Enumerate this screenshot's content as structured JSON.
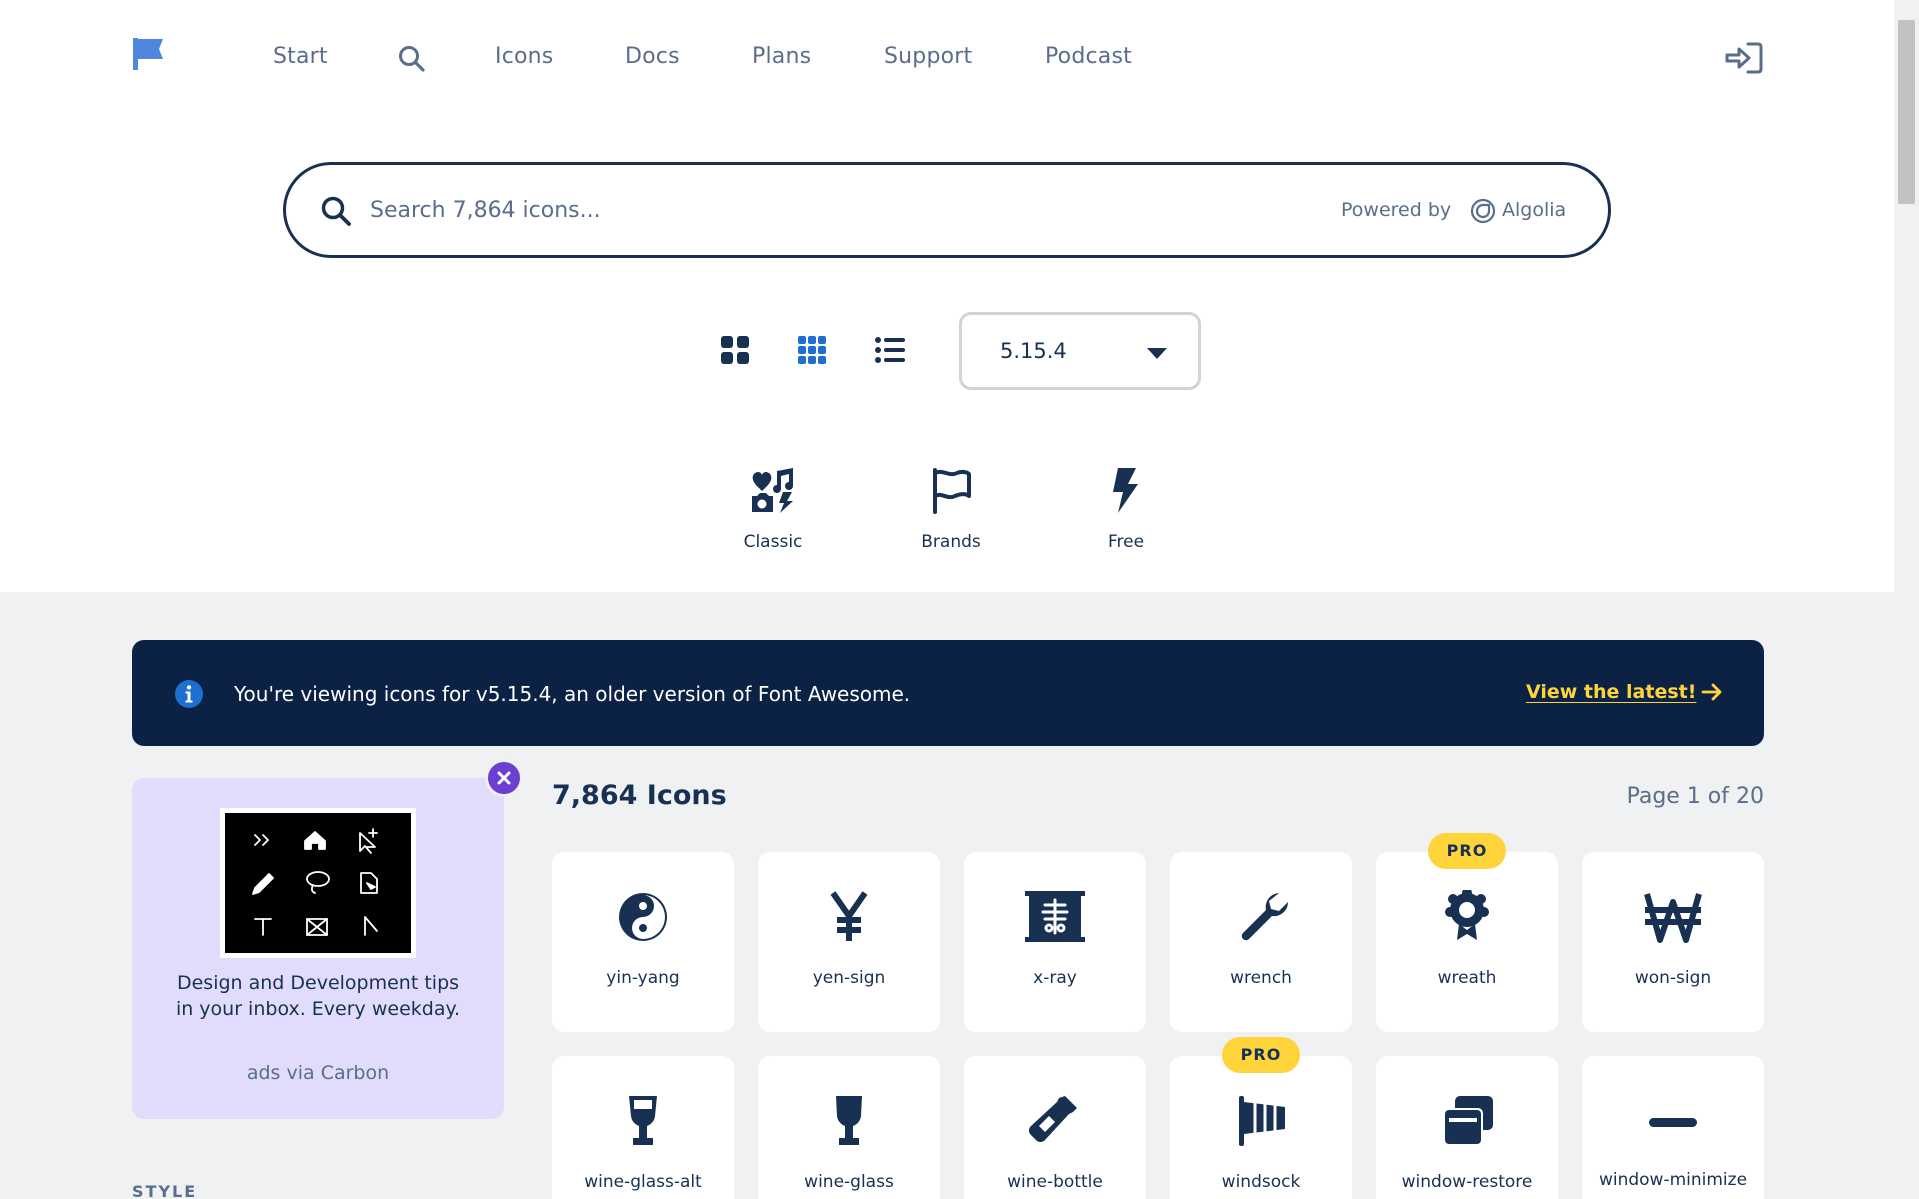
{
  "nav": {
    "links": [
      "Start",
      "Icons",
      "Docs",
      "Plans",
      "Support",
      "Podcast"
    ]
  },
  "search": {
    "placeholder": "Search 7,864 icons...",
    "powered_by": "Powered by",
    "provider": "Algolia"
  },
  "view": {
    "version": "5.15.4",
    "families": [
      "Classic",
      "Brands",
      "Free"
    ]
  },
  "banner": {
    "text": "You're viewing icons for v5.15.4, an older version of Font Awesome.",
    "link": "View the latest!"
  },
  "ad": {
    "text": "Design and Development tips in your inbox. Every weekday.",
    "via": "ads via Carbon"
  },
  "sidebar": {
    "style_label": "STYLE"
  },
  "results": {
    "count": "7,864 Icons",
    "page": "Page 1 of 20",
    "icons": [
      {
        "name": "yin-yang",
        "pro": ""
      },
      {
        "name": "yen-sign",
        "pro": ""
      },
      {
        "name": "x-ray",
        "pro": ""
      },
      {
        "name": "wrench",
        "pro": ""
      },
      {
        "name": "wreath",
        "pro": "PRO"
      },
      {
        "name": "won-sign",
        "pro": ""
      },
      {
        "name": "wine-glass-alt",
        "pro": ""
      },
      {
        "name": "wine-glass",
        "pro": ""
      },
      {
        "name": "wine-bottle",
        "pro": ""
      },
      {
        "name": "windsock",
        "pro": "PRO"
      },
      {
        "name": "window-restore",
        "pro": ""
      },
      {
        "name": "window-minimize",
        "pro": ""
      }
    ]
  },
  "colors": {
    "navy": "#183153",
    "banner_bg": "#0b2245",
    "accent_yellow": "#ffd43b",
    "ad_bg": "#e1dcfb",
    "close_purple": "#6c3fd1",
    "logo_blue": "#4f87e0"
  }
}
